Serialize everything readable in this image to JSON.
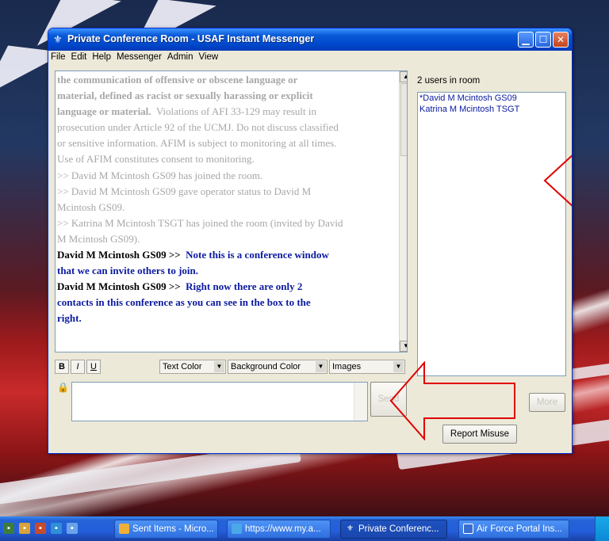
{
  "window": {
    "title": "Private Conference Room - USAF Instant Messenger",
    "icon": "shield-icon",
    "controls": [
      "minimize-icon",
      "maximize-icon",
      "close-icon"
    ]
  },
  "menu": {
    "items": [
      "File",
      "Edit",
      "Help",
      "Messenger",
      "Admin",
      "View"
    ]
  },
  "chat_log": {
    "system_lines": [
      "the communication of offensive or obscene language or",
      "material, defined as racist or sexually harassing or explicit",
      "language or material.",
      "Violations of AFI 33-129 may result in",
      "prosecution under Article 92 of the UCMJ. Do not discuss classified",
      "or sensitive information. AFIM is subject to monitoring at all times.",
      "Use of AFIM constitutes consent to monitoring.",
      ">> David M Mcintosh GS09 has joined the room.",
      ">> David M Mcintosh GS09 gave operator status to David M",
      "Mcintosh GS09.",
      ">> Katrina M Mcintosh TSGT has joined the room (invited by David",
      "M Mcintosh GS09)."
    ],
    "messages": [
      {
        "sender": "David M Mcintosh GS09 >>",
        "lines": [
          "Note this is a conference window",
          "that we can invite others to join."
        ]
      },
      {
        "sender": "David M Mcintosh GS09 >>",
        "lines": [
          "Right now there are only 2",
          "contacts in this conference as you can see in the box to the",
          "right."
        ]
      }
    ]
  },
  "users": {
    "count_label": "2 users in room",
    "list": [
      "*David M Mcintosh GS09",
      "Katrina M Mcintosh TSGT"
    ]
  },
  "formatting": {
    "bold": "B",
    "italic": "I",
    "underline": "U",
    "text_color": "Text Color",
    "background_color": "Background Color",
    "images": "Images"
  },
  "compose": {
    "value": "",
    "send_label": "Send",
    "more_label": "More",
    "report_label": "Report Misuse"
  },
  "taskbar": {
    "tasks": [
      {
        "label": "Sent Items - Micro...",
        "icon": "outlook-icon"
      },
      {
        "label": "https://www.my.a...",
        "icon": "ie-icon"
      },
      {
        "label": "Private Conferenc...",
        "icon": "shield-icon"
      },
      {
        "label": "Air Force Portal Ins...",
        "icon": "word-icon"
      }
    ]
  },
  "colors": {
    "title_blue": "#0049cc",
    "message_blue": "#0a1aa0",
    "arrow_red": "#e10000",
    "window_bg": "#ece9d8"
  }
}
